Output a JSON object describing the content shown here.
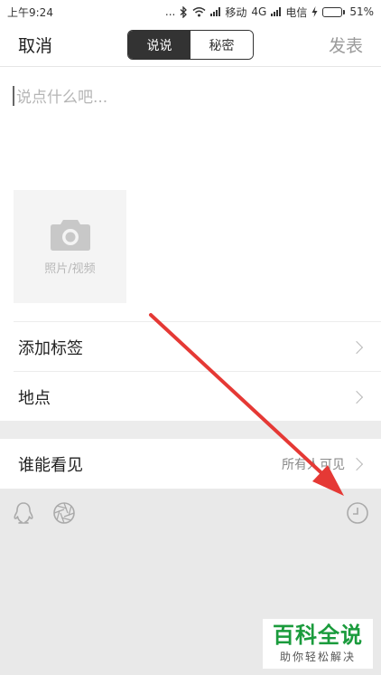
{
  "status_bar": {
    "time": "上午9:24",
    "dots": "...",
    "carrier1": "移动",
    "network": "4G",
    "carrier2": "电信",
    "battery": "51%",
    "battery_level": 0.51
  },
  "header": {
    "cancel_label": "取消",
    "publish_label": "发表",
    "tabs": [
      {
        "label": "说说",
        "active": true
      },
      {
        "label": "秘密",
        "active": false
      }
    ]
  },
  "compose": {
    "placeholder": "说点什么吧...",
    "photo_label": "照片/视频"
  },
  "rows": {
    "add_tag": "添加标签",
    "location": "地点",
    "visibility_label": "谁能看见",
    "visibility_value": "所有人可见"
  },
  "toolbar": {
    "icons": [
      "qq-penguin-icon",
      "aperture-icon",
      "clock-icon"
    ]
  },
  "watermark": {
    "main": "百科全说",
    "sub": "助你轻松解决"
  },
  "colors": {
    "accent_dark": "#333333",
    "arrow": "#e53935",
    "watermark_green": "#1a9b3c"
  }
}
